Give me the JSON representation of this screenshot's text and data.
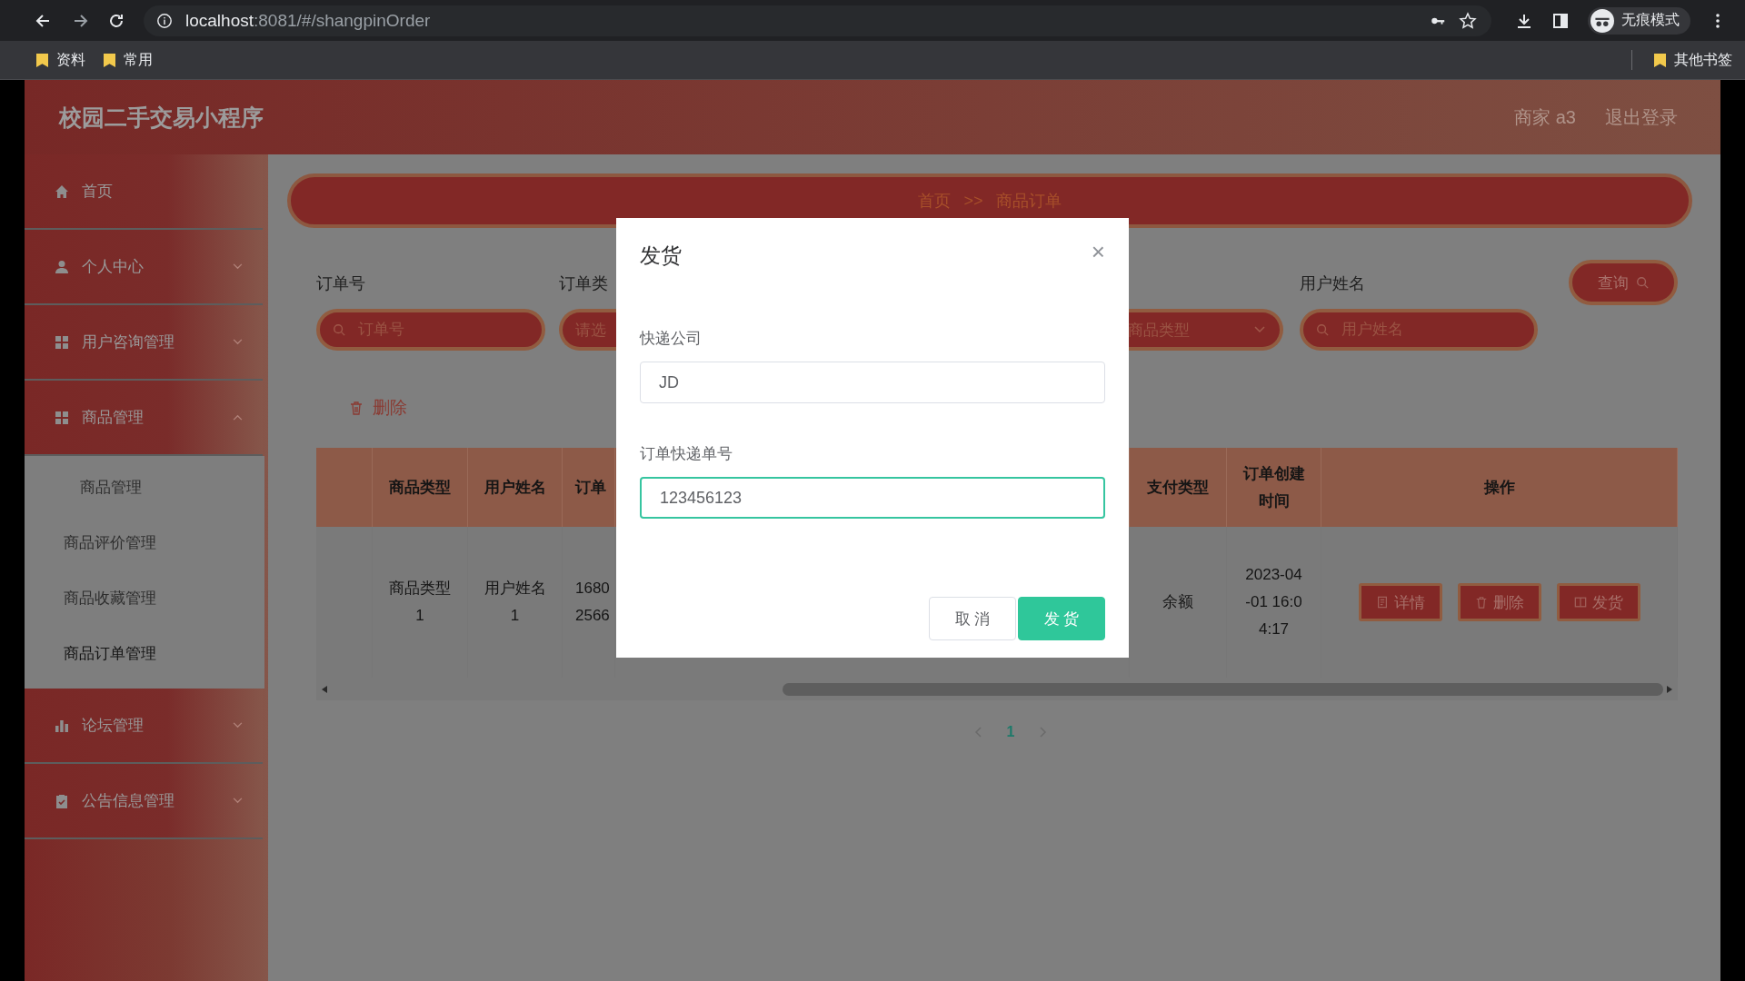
{
  "browser": {
    "url_host": "localhost",
    "url_rest": ":8081/#/shangpinOrder",
    "profile": "无痕模式",
    "bookmarks": [
      "资料",
      "常用"
    ],
    "other_bookmarks": "其他书签"
  },
  "header": {
    "title": "校园二手交易小程序",
    "user": "商家 a3",
    "logout": "退出登录"
  },
  "sidebar": {
    "items": [
      {
        "label": "首页"
      },
      {
        "label": "个人中心",
        "expanded": false
      },
      {
        "label": "用户咨询管理",
        "expanded": false
      },
      {
        "label": "商品管理",
        "expanded": true,
        "children": [
          {
            "label": "商品管理",
            "selected": false
          },
          {
            "label": "商品评价管理",
            "selected": false
          },
          {
            "label": "商品收藏管理",
            "selected": false
          },
          {
            "label": "商品订单管理",
            "selected": true
          }
        ]
      },
      {
        "label": "论坛管理",
        "expanded": false
      },
      {
        "label": "公告信息管理",
        "expanded": false
      }
    ]
  },
  "breadcrumb": [
    "首页",
    ">>",
    "商品订单"
  ],
  "filters": [
    {
      "kind": "input",
      "label": "订单号",
      "placeholder": "订单号"
    },
    {
      "kind": "select_cut",
      "label": "订单类",
      "placeholder": "请选"
    },
    {
      "kind": "select_rest",
      "placeholder": "商品类型"
    },
    {
      "kind": "input",
      "label": "用户姓名",
      "placeholder": "用户姓名"
    }
  ],
  "search_button": "查询",
  "delete_button": "删除",
  "table": {
    "columns": [
      "",
      "商品类型",
      "用户姓名",
      "订单",
      "",
      "支付类型",
      "订单创建时间",
      "操作"
    ],
    "rows": [
      {
        "cells": [
          "",
          "商品类型1",
          "用户姓名1",
          "1680 2566",
          "",
          "余额",
          "2023-04-01 16:04:17"
        ],
        "actions": [
          "详情",
          "删除",
          "发货"
        ]
      }
    ]
  },
  "pagination": {
    "pages": [
      {
        "label": "1",
        "selected": true
      }
    ]
  },
  "dialog": {
    "title": "发货",
    "close": "×",
    "fields": [
      {
        "label": "快递公司",
        "value": "JD",
        "focused": false
      },
      {
        "label": "订单快递单号",
        "value": "123456123",
        "focused": true
      }
    ],
    "cancel": "取 消",
    "confirm": "发 货"
  }
}
